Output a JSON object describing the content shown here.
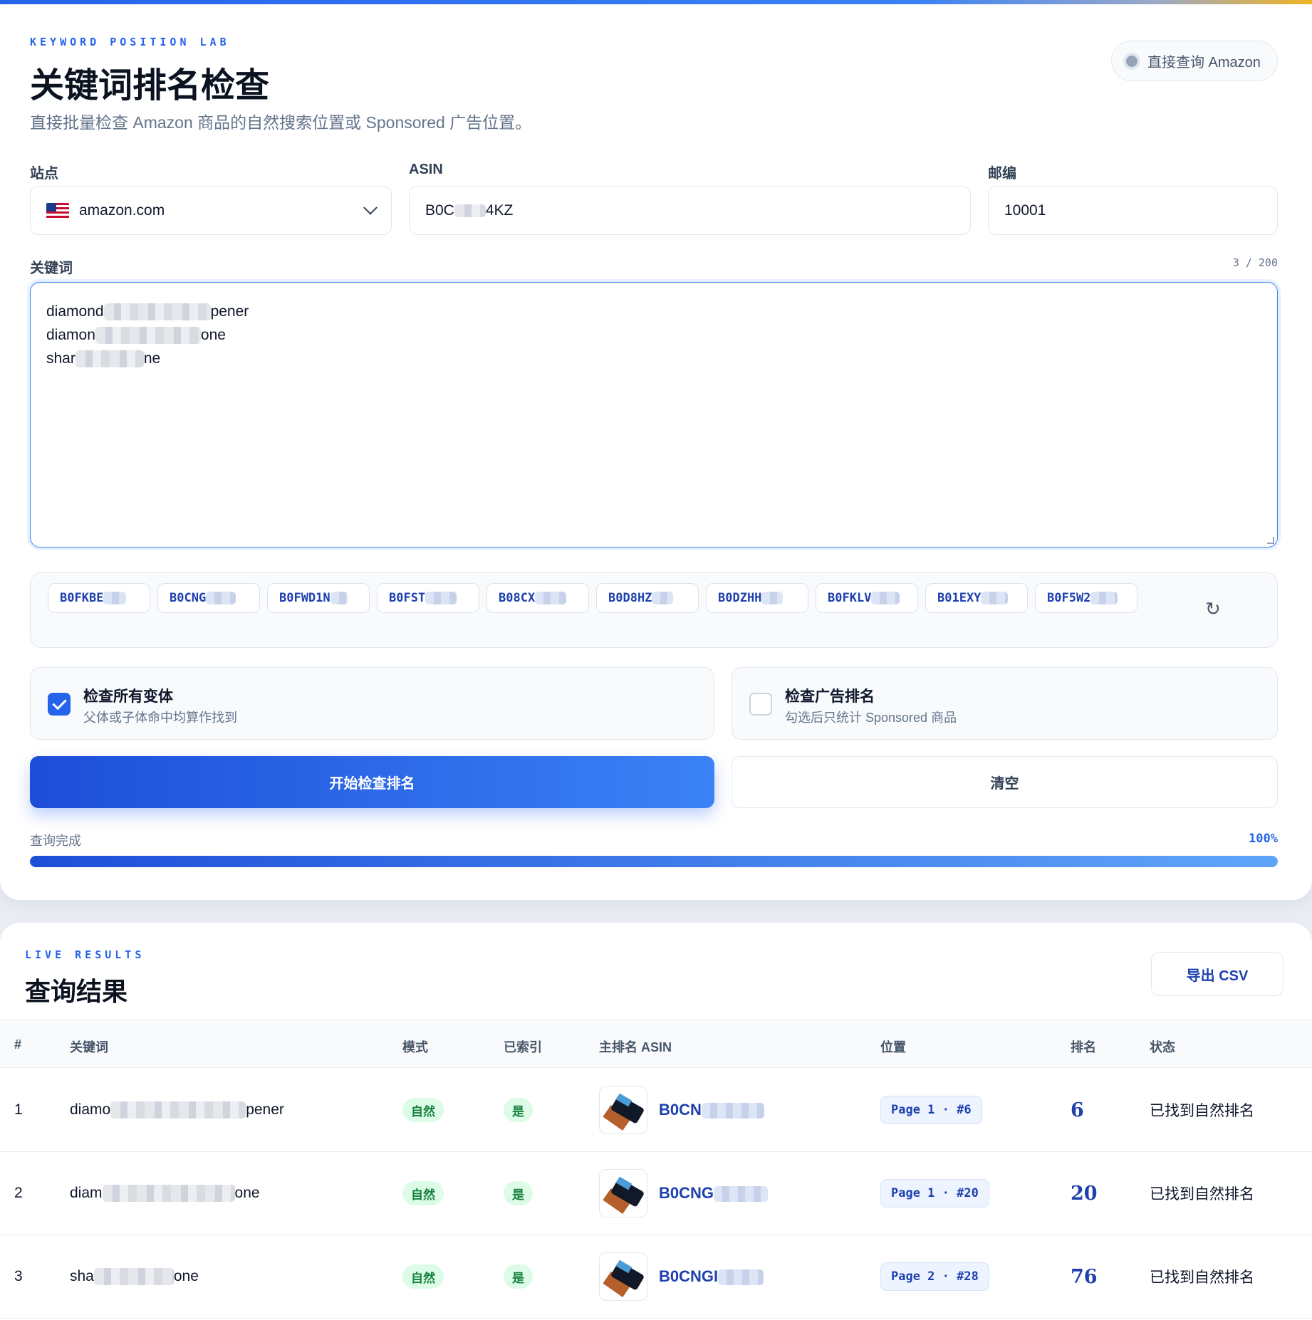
{
  "form": {
    "eyebrow": "KEYWORD POSITION LAB",
    "title": "关键词排名检查",
    "subtitle": "直接批量检查 Amazon 商品的自然搜索位置或 Sponsored 广告位置。",
    "mode_pill": "直接查询 Amazon",
    "site_label": "站点",
    "site_value": "amazon.com",
    "asin_label": "ASIN",
    "asin_prefix": "B0C",
    "asin_suffix": "4KZ",
    "zip_label": "邮编",
    "zip_value": "10001",
    "keywords_label": "关键词",
    "keywords_counter": "3 / 200",
    "keywords": [
      {
        "start": "diamond",
        "end": "pener"
      },
      {
        "start": "diamon",
        "end": "one"
      },
      {
        "start": "shar",
        "end": "ne"
      }
    ],
    "asin_chips": [
      "B0FKBE",
      "B0CNG",
      "B0FWD1N",
      "B0FST",
      "B08CX",
      "B0D8HZ",
      "B0DZHH",
      "B0FKLV",
      "B01EXY",
      "B0F5W2"
    ],
    "option_variants_title": "检查所有变体",
    "option_variants_desc": "父体或子体命中均算作找到",
    "option_variants_checked": true,
    "option_ads_title": "检查广告排名",
    "option_ads_desc": "勾选后只统计 Sponsored 商品",
    "option_ads_checked": false,
    "start_button": "开始检查排名",
    "clear_button": "清空",
    "status_text": "查询完成",
    "progress_label": "100%",
    "progress_value": 1.0
  },
  "results": {
    "eyebrow": "LIVE RESULTS",
    "title": "查询结果",
    "export_button": "导出 CSV",
    "headers": [
      "#",
      "关键词",
      "模式",
      "已索引",
      "主排名 ASIN",
      "位置",
      "排名",
      "状态"
    ],
    "rows": [
      {
        "num": "1",
        "kw_start": "diamo",
        "kw_end": "pener",
        "mode": "自然",
        "indexed": "是",
        "asin": "B0CN",
        "position": "Page 1 · #6",
        "rank": "6",
        "status": "已找到自然排名"
      },
      {
        "num": "2",
        "kw_start": "diam",
        "kw_end": "one",
        "mode": "自然",
        "indexed": "是",
        "asin": "B0CNG",
        "position": "Page 1 · #20",
        "rank": "20",
        "status": "已找到自然排名"
      },
      {
        "num": "3",
        "kw_start": "sha",
        "kw_end": "one",
        "mode": "自然",
        "indexed": "是",
        "asin": "B0CNGI",
        "position": "Page 2 · #28",
        "rank": "76",
        "status": "已找到自然排名"
      }
    ]
  },
  "colors": {
    "accent": "#2563eb",
    "brand_dark": "#1e40af",
    "success_bg": "#dcfce7",
    "success_text": "#15803d"
  }
}
